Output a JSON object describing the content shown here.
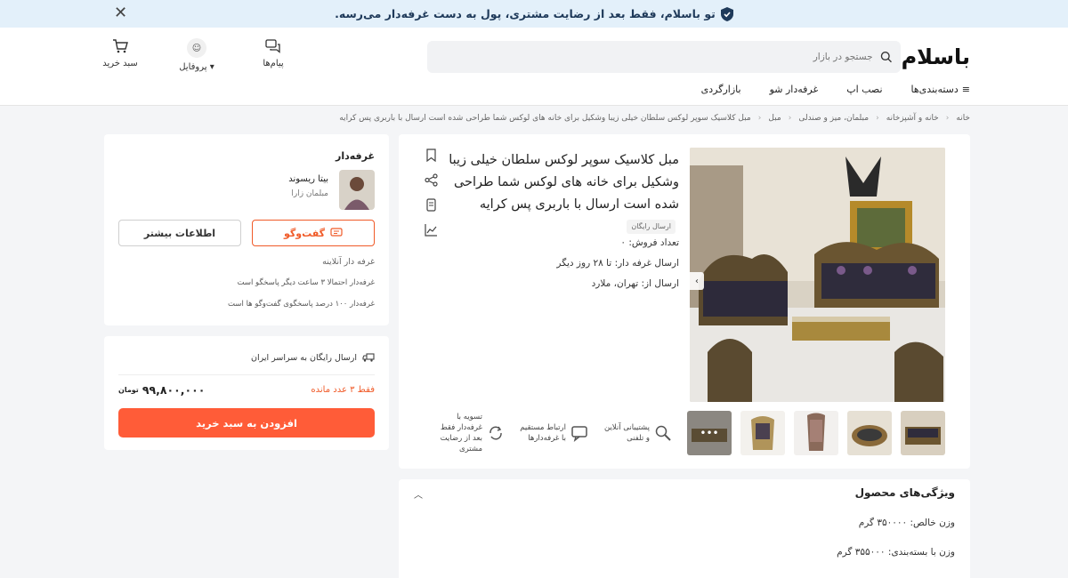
{
  "banner": {
    "text": "تو باسلام، فقط بعد از رضایت مشتری، پول به دست غرفه‌دار می‌رسه.",
    "close": "✕"
  },
  "header": {
    "logo": "باسلام",
    "search_placeholder": "جستجو در بازار",
    "actions": {
      "messages": "پیام‌ها",
      "profile": "پروفایل",
      "cart": "سبد خرید"
    },
    "nav": [
      "دسته‌بندی‌ها",
      "نصب اپ",
      "غرفه‌دار شو",
      "بازارگردی"
    ]
  },
  "breadcrumb": [
    "خانه",
    "خانه و آشپزخانه",
    "مبلمان، میز و صندلی",
    "مبل",
    "مبل کلاسیک سوپر لوکس سلطان خیلی زیبا وشکیل برای خانه های لوکس شما طراحی شده است ارسال با باربری پس کرایه"
  ],
  "product": {
    "title": "مبل کلاسیک سوپر لوکس سلطان خیلی زیبا وشکیل برای خانه های لوکس شما طراحی شده است ارسال با باربری پس کرایه",
    "free_badge": "ارسال رایگان",
    "sales_count": "تعداد فروش: ۰",
    "ship_time": "ارسال غرفه دار:  تا ۲۸ روز دیگر",
    "ship_from": "ارسال از:  تهران، ملارد",
    "features": [
      "پشتیبانی آنلاین و تلفنی",
      "ارتباط مستقیم با غرفه‌دارها",
      "تسویه با غرفه‌دار فقط بعد از رضایت مشتری"
    ],
    "thumb_more": "•••"
  },
  "specs": {
    "title": "ویژگی‌های محصول",
    "rows": [
      "وزن خالص: ۳۵۰۰۰۰ گرم",
      "وزن با بسته‌بندی: ۳۵۵۰۰۰ گرم"
    ]
  },
  "seller": {
    "heading": "غرفه‌دار",
    "name": "بیتا ریسوند",
    "shop": "مبلمان زارا",
    "chat_button": "گفت‌وگو",
    "info_button": "اطلاعات بیشتر",
    "online": "غرفه دار آنلاینه",
    "response_time": "غرفه‌دار احتمالا ۳ ساعت دیگر پاسخگو است",
    "response_rate": "غرفه‌دار ۱۰۰ درصد پاسخگوی گفت‌وگو ها است"
  },
  "buy": {
    "shipping": "ارسال رایگان به سراسر ایران",
    "stock": "فقط ۳ عدد مانده",
    "price": "۹۹,۸۰۰,۰۰۰",
    "currency": "تومان",
    "add_to_cart": "افزودن به سبد خرید"
  }
}
